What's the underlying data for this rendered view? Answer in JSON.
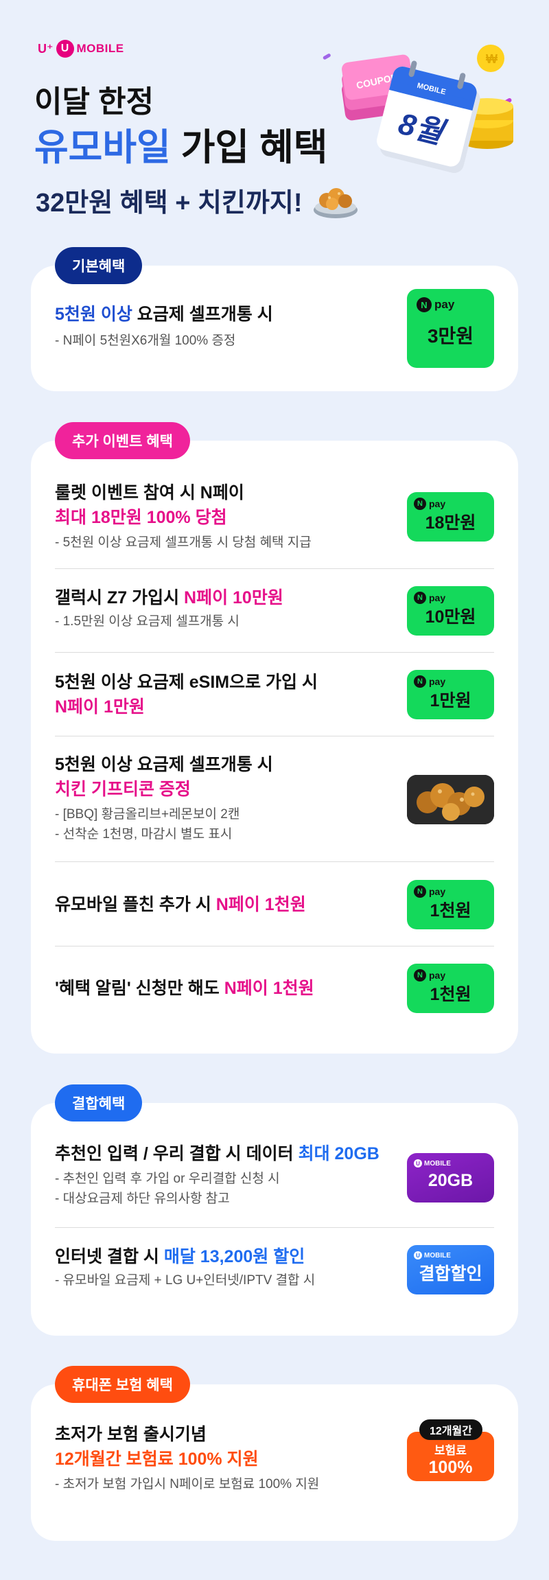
{
  "brand": {
    "u": "U⁺",
    "circle": "U",
    "mobile": "MOBILE"
  },
  "hero": {
    "line1": "이달 한정",
    "line2_blue": "유모바일",
    "line2_black": "가입 혜택",
    "line3": "32만원 혜택 + 치킨까지!",
    "art_calendar_text": "8월",
    "art_coupon_text": "COUPON",
    "art_calendar_brand": "MOBILE"
  },
  "basic": {
    "pill": "기본혜택",
    "title_hl": "5천원 이상",
    "title_rest": " 요금제 셀프개통 시",
    "sub": "- N페이 5천원X6개월 100% 증정",
    "badge_head": "pay",
    "badge_amount": "3만원"
  },
  "extra": {
    "pill": "추가 이벤트 혜택",
    "items": [
      {
        "line1": "룰렛 이벤트 참여 시 N페이",
        "line2": "최대 18만원 100% 당첨",
        "sub1": "-  5천원 이상 요금제 셀프개통 시 당첨 혜택 지급",
        "badge": "18만원"
      },
      {
        "line1": "갤럭시 Z7 가입시 ",
        "line1_hl": "N페이 10만원",
        "sub1": "- 1.5만원 이상 요금제 셀프개통 시",
        "badge": "10만원"
      },
      {
        "line1": "5천원 이상 요금제 eSIM으로 가입 시",
        "line2": "N페이 1만원",
        "badge": "1만원"
      },
      {
        "line1": "5천원 이상 요금제 셀프개통 시",
        "line2": "치킨 기프티콘 증정",
        "sub1": "- [BBQ] 황금올리브+레몬보이 2캔",
        "sub2": "- 선착순 1천명, 마감시 별도 표시"
      },
      {
        "line1": "유모바일 플친 추가 시 ",
        "line1_hl": "N페이 1천원",
        "badge": "1천원"
      },
      {
        "line1": "'혜택 알림' 신청만 해도 ",
        "line1_hl": "N페이 1천원",
        "badge": "1천원"
      }
    ],
    "badge_head": "pay"
  },
  "combo": {
    "pill": "결합혜택",
    "items": [
      {
        "line1": "추천인 입력 / 우리 결합 시 데이터 ",
        "line1_hl": "최대 20GB",
        "sub1": "- 추천인 입력 후 가입 or 우리결합 신청 시",
        "sub2": "- 대상요금제 하단 유의사항 참고",
        "badge": "20GB"
      },
      {
        "line1": "인터넷 결합 시 ",
        "line1_hl": "매달 13,200원 할인",
        "sub1": "- 유모바일 요금제 + LG U+인터넷/IPTV 결합 시",
        "badge": "결합할인"
      }
    ],
    "badge_brand": "MOBILE"
  },
  "insurance": {
    "pill": "휴대폰 보험 혜택",
    "line1": "초저가 보험 출시기념",
    "line2": "12개월간 보험료 100% 지원",
    "sub1": "- 초저가 보험 가입시 N페이로 보험료 100% 지원",
    "tag": "12개월간",
    "box_l1": "보험료",
    "box_l2": "100%"
  },
  "colors": {
    "bg": "#eaf0fb",
    "navy": "#0d2c8c",
    "pink": "#f0239b",
    "blue": "#1f6cf0",
    "orange": "#ff4d10",
    "npay_green": "#14d95b",
    "purple": "#7a1fb8"
  },
  "icons": {
    "npay": "npay-logo-icon",
    "chicken": "chicken-icon",
    "calendar": "calendar-icon",
    "coupon": "coupon-icon",
    "coin": "coin-icon"
  }
}
